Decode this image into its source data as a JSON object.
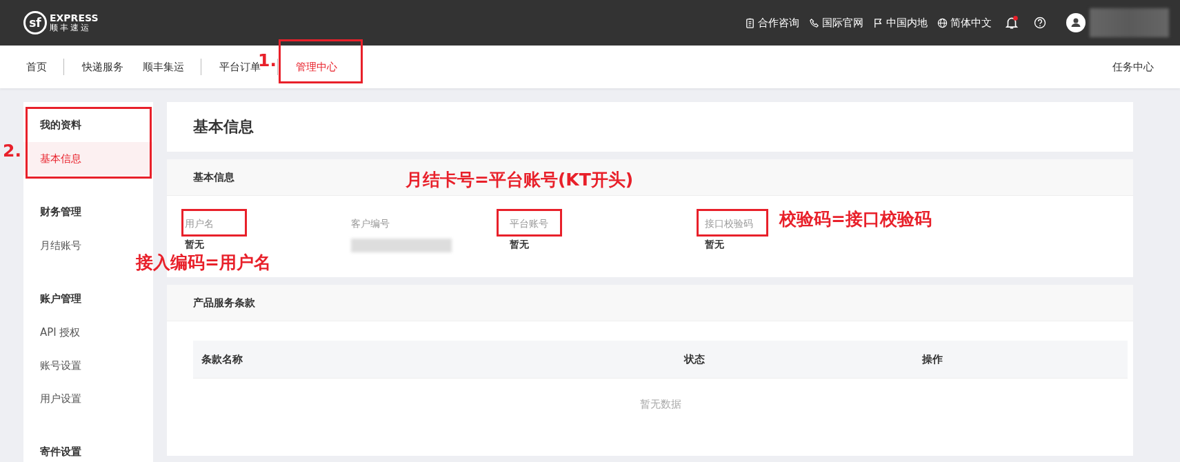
{
  "header": {
    "logo": {
      "mark": "sf",
      "wordmark": "EXPRESS",
      "name": "顺丰速运"
    },
    "links": [
      {
        "kind": "clipboard",
        "label": "合作咨询"
      },
      {
        "kind": "phone",
        "label": "国际官网"
      },
      {
        "kind": "flag",
        "label": "中国内地"
      },
      {
        "kind": "globe",
        "label": "简体中文"
      }
    ],
    "notifications": {
      "unread": true
    },
    "user": {
      "redacted": true
    }
  },
  "nav": {
    "items": [
      {
        "label": "首页",
        "selected": false,
        "separator": true
      },
      {
        "label": "快递服务",
        "selected": false,
        "separator": false
      },
      {
        "label": "顺丰集运",
        "selected": false,
        "separator": true
      },
      {
        "label": "平台订单",
        "selected": false,
        "separator": true,
        "marker": "1."
      },
      {
        "label": "管理中心",
        "selected": true,
        "separator": false,
        "highlighted": true
      }
    ],
    "right": "任务中心"
  },
  "sidebar": {
    "groups": [
      {
        "title": "我的资料",
        "highlighted": true,
        "marker": "2.",
        "items": [
          {
            "label": "基本信息",
            "selected": true
          }
        ]
      },
      {
        "title": "财务管理",
        "items": [
          {
            "label": "月结账号",
            "selected": false
          }
        ]
      },
      {
        "title": "账户管理",
        "items": [
          {
            "label": "API 授权",
            "selected": false
          },
          {
            "label": "账号设置",
            "selected": false
          },
          {
            "label": "用户设置",
            "selected": false
          }
        ]
      },
      {
        "title": "寄件设置"
      }
    ]
  },
  "page_title": "基本信息",
  "info": {
    "title": "基本信息",
    "fields": [
      {
        "label": "用户名",
        "value": "暂无",
        "highlighted": true,
        "note": "接入编码=用户名"
      },
      {
        "label": "客户编号",
        "redacted": true
      },
      {
        "label": "平台账号",
        "value": "暂无",
        "highlighted": true,
        "note": "月结卡号=平台账号(KT开头)"
      },
      {
        "label": "接口校验码",
        "value": "暂无",
        "highlighted": true,
        "note": "校验码=接口校验码"
      }
    ]
  },
  "terms": {
    "title": "产品服务条款",
    "columns": [
      "条款名称",
      "状态",
      "操作"
    ],
    "empty": "暂无数据"
  }
}
